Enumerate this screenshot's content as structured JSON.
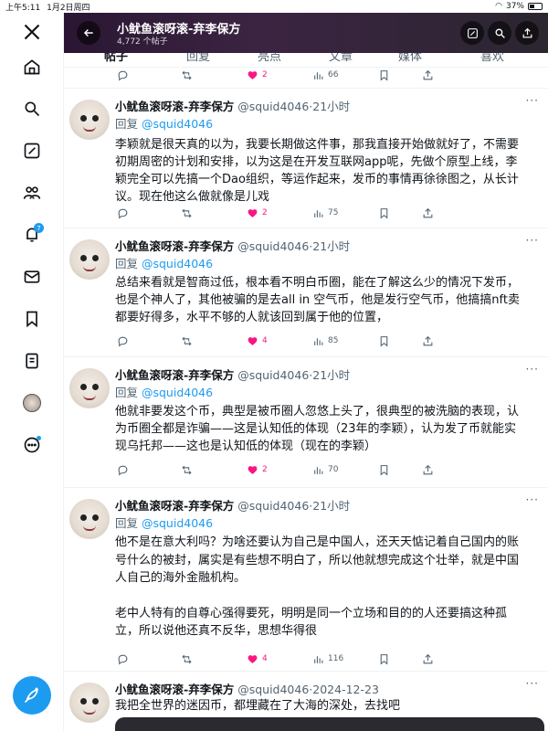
{
  "status": {
    "time": "上午5:11",
    "date": "1月2日周四",
    "battery": "37%"
  },
  "header": {
    "title": "小鱿鱼滚呀滚-弃李保方",
    "subtitle": "4,772 个帖子"
  },
  "tabs": [
    "帖子",
    "回复",
    "亮点",
    "文章",
    "媒体",
    "喜欢"
  ],
  "nav": {
    "notifications_badge": "7"
  },
  "top_actions": {
    "likes": "2",
    "views": "66"
  },
  "tweets": [
    {
      "name": "小鱿鱼滚呀滚-弃李保方",
      "handle": "@squid4046·21小时",
      "reply_prefix": "回复 ",
      "reply_to": "@squid4046",
      "lines": [
        "李颖就是很天真的以为，我要长期做这件事，那我直接开始做就好了，不需要",
        "初期周密的计划和安排，以为这是在开发互联网app呢，先做个原型上线，李",
        "颖完全可以先搞一个Dao组织，等运作起来，发币的事情再徐徐图之，从长计",
        "议。现在他这么做就像是儿戏"
      ],
      "likes": "2",
      "views": "75"
    },
    {
      "name": "小鱿鱼滚呀滚-弃李保方",
      "handle": "@squid4046·21小时",
      "reply_prefix": "回复 ",
      "reply_to": "@squid4046",
      "lines": [
        "总结来看就是智商过低，根本看不明白币圈，能在了解这么少的情况下发币，",
        "也是个神人了，其他被骗的是去all in 空气币，他是发行空气币，他搞搞nft卖",
        "都要好得多，水平不够的人就该回到属于他的位置，"
      ],
      "likes": "4",
      "views": "85"
    },
    {
      "name": "小鱿鱼滚呀滚-弃李保方",
      "handle": "@squid4046·21小时",
      "reply_prefix": "回复 ",
      "reply_to": "@squid4046",
      "lines": [
        "他就非要发这个币，典型是被币圈人忽悠上头了，很典型的被洗脑的表现，认",
        "为币圈全都是诈骗——这是认知低的体现（23年的李颖），认为发了币就能实",
        "现乌托邦——这也是认知低的体现（现在的李颖）"
      ],
      "likes": "2",
      "views": "70"
    },
    {
      "name": "小鱿鱼滚呀滚-弃李保方",
      "handle": "@squid4046·21小时",
      "reply_prefix": "回复 ",
      "reply_to": "@squid4046",
      "lines": [
        "他不是在意大利吗？为啥还要认为自己是中国人，还天天惦记着自己国内的账",
        "号什么的被封，属实是有些想不明白了，所以他就想完成这个壮举，就是中国",
        "人自己的海外金融机构。",
        "",
        "老中人特有的自尊心强得要死，明明是同一个立场和目的的人还要搞这种孤",
        "立，所以说他还真不反华，思想华得很"
      ],
      "likes": "4",
      "views": "116"
    },
    {
      "name": "小鱿鱼滚呀滚-弃李保方",
      "handle": "@squid4046·2024-12-23",
      "reply_prefix": "",
      "reply_to": "",
      "lines": [
        "我把全世界的迷因币，都埋藏在了大海的深处，去找吧"
      ],
      "likes": "",
      "views": ""
    }
  ]
}
